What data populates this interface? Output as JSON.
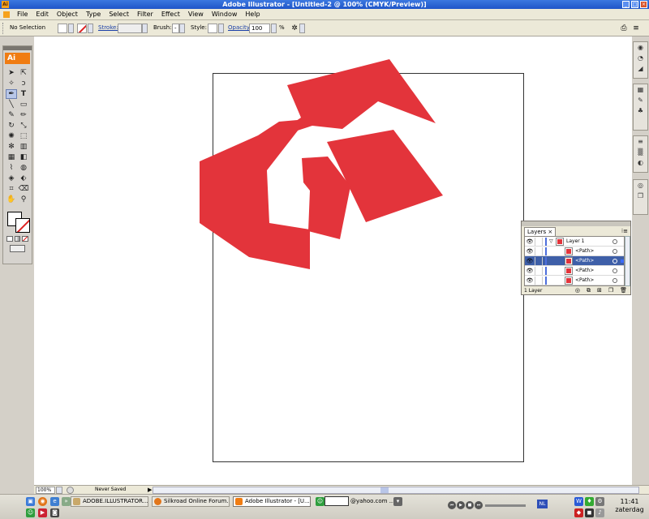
{
  "window": {
    "title": "Adobe Illustrator - [Untitled-2 @ 100% (CMYK/Preview)]",
    "app_icon": "Ai"
  },
  "menu": [
    "File",
    "Edit",
    "Object",
    "Type",
    "Select",
    "Filter",
    "Effect",
    "View",
    "Window",
    "Help"
  ],
  "control_bar": {
    "selection": "No Selection",
    "stroke_label": "Stroke:",
    "brush_label": "Brush:",
    "brush_value": "-",
    "style_label": "Style:",
    "opacity_label": "Opacity:",
    "opacity_value": "100",
    "opacity_unit": "%"
  },
  "tools_panel": {
    "logo": "Ai"
  },
  "artwork": {
    "fill_color": "#e3343b"
  },
  "layers_panel": {
    "tab": "Layers",
    "menu_icon": "⁝≡",
    "rows": [
      {
        "name": "Layer 1",
        "type": "layer"
      },
      {
        "name": "<Path>",
        "type": "path"
      },
      {
        "name": "<Path>",
        "type": "path",
        "selected": true
      },
      {
        "name": "<Path>",
        "type": "path"
      },
      {
        "name": "<Path>",
        "type": "path"
      }
    ],
    "footer": "1 Layer"
  },
  "status_bar": {
    "zoom": "100%",
    "status": "Never Saved"
  },
  "taskbar": {
    "buttons": [
      {
        "label": "ADOBE.ILLUSTRATOR...",
        "icon_color": "#c9a86a"
      },
      {
        "label": "Silkroad Online Forum...",
        "icon_color": "#e2761b"
      },
      {
        "label": "Adobe Illustrator - [U...",
        "icon_color": "#f07c12",
        "active": true
      }
    ],
    "email_suffix": "@yahoo.com ...",
    "language": "NL",
    "time": "11:41",
    "day": "zaterdag"
  }
}
